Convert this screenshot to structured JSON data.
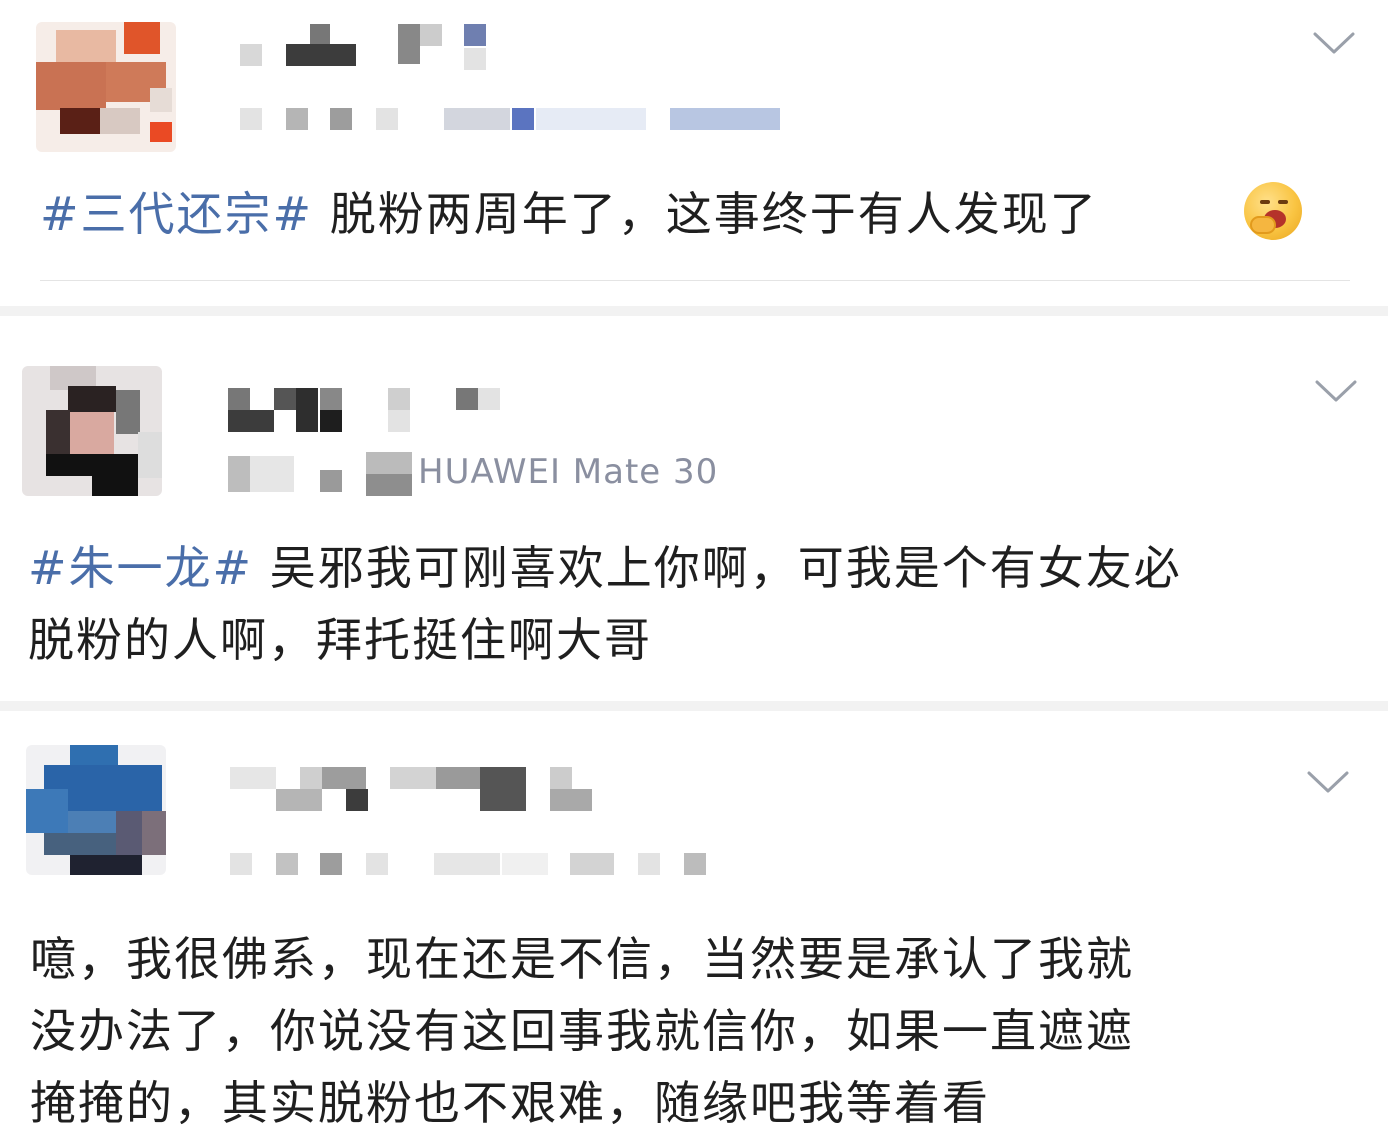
{
  "posts": [
    {
      "content_hashtag": "#三代还宗#",
      "content_text": " 脱粉两周年了，这事终于有人发现了",
      "emoji": "yawning-face-icon"
    },
    {
      "device": "HUAWEI Mate 30",
      "content_hashtag": "#朱一龙#",
      "content_line1": " 吴邪我可刚喜欢上你啊，可我是个有女友必",
      "content_line2": "脱粉的人啊，拜托挺住啊大哥"
    },
    {
      "content_line1": "噫，我很佛系，现在还是不信，当然要是承认了我就",
      "content_line2": "没办法了，你说没有这回事我就信你，如果一直遮遮",
      "content_line3": "掩掩的，其实脱粉也不艰难，随缘吧我等着看"
    }
  ],
  "colors": {
    "hashtag": "#4a6ea9",
    "text": "#1f1f1f",
    "meta": "#8a8fa0",
    "chevron": "#9aa0aa",
    "separator": "#f2f2f2"
  }
}
